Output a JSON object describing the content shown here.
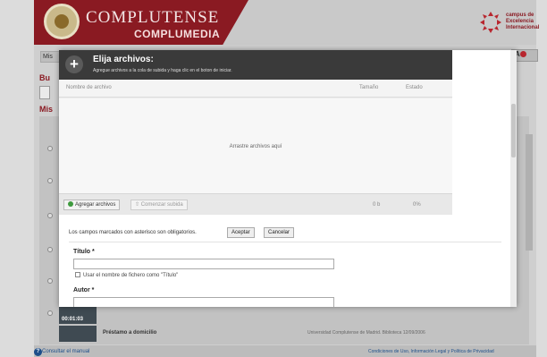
{
  "header": {
    "brand_title": "COMPLUTENSE",
    "brand_sub": "COMPLUMEDIA",
    "excellence_lines": [
      "campus de",
      "Excelencia",
      "Internacional"
    ]
  },
  "background": {
    "tab_label": "Mis",
    "section_bu": "Bu",
    "section_mis": "Mis",
    "right_button_label": "A",
    "thumb_time": "00:01:03",
    "row_title": "Préstamo a domicilio",
    "row_meta": "Universidad Complutense de Madrid. Biblioteca 12/09/2006",
    "footer_help": "Consultar el manual",
    "footer_right": "Condiciones de Uso, Información Legal y Política de Privacidad"
  },
  "uploader": {
    "title": "Elija archivos:",
    "subtitle": "Agregue archivos a la cola de subida y haga clic en el boton de iniciar.",
    "col_name": "Nombre de archivo",
    "col_size": "Tamaño",
    "col_status": "Estado",
    "drop_text": "Arrastre archivos aquí",
    "add_button": "Agregar archivos",
    "start_button": "Comenzar subida",
    "total_size": "0 b",
    "total_percent": "0%"
  },
  "form": {
    "note": "Los campos marcados con asterisco son obligatorios.",
    "accept_button": "Aceptar",
    "cancel_button": "Cancelar",
    "title_label": "Título *",
    "title_value": "",
    "checkbox_label": "Usar el nombre de fichero como \"Título\"",
    "author_label": "Autor *",
    "author_value": ""
  },
  "colors": {
    "brand": "#8a1a22",
    "header_dark": "#3a3a3a",
    "link": "#1d4e8a"
  }
}
